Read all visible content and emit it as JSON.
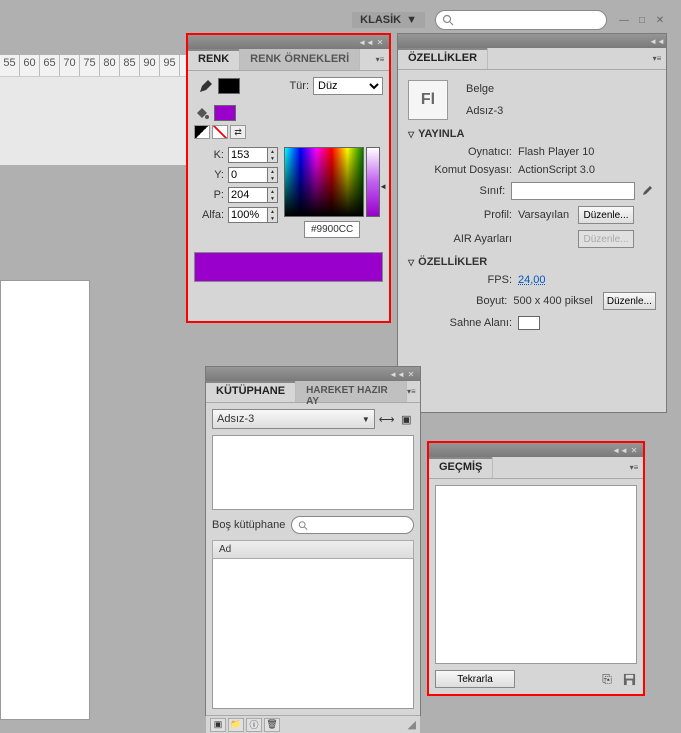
{
  "topbar": {
    "workspace": "KLASİK",
    "search_placeholder": ""
  },
  "ruler_ticks": [
    "55",
    "60",
    "65",
    "70",
    "75",
    "80",
    "85",
    "90",
    "95"
  ],
  "renk": {
    "tab_active": "RENK",
    "tab_inactive": "RENK ÖRNEKLERİ",
    "tur_label": "Tür:",
    "tur_value": "Düz",
    "stroke_color": "#000000",
    "fill_color": "#9900CC",
    "k_label": "K:",
    "k_value": "153",
    "y_label": "Y:",
    "y_value": "0",
    "p_label": "P:",
    "p_value": "204",
    "alfa_label": "Alfa:",
    "alfa_value": "100%",
    "hex": "#9900CC"
  },
  "ozellik": {
    "tab": "ÖZELLİKLER",
    "doc_icon_text": "Fl",
    "belge_label": "Belge",
    "dosya_name": "Adsız-3",
    "yayinla_header": "YAYINLA",
    "oynatici_label": "Oynatıcı:",
    "oynatici_value": "Flash Player 10",
    "komut_label": "Komut Dosyası:",
    "komut_value": "ActionScript 3.0",
    "sinif_label": "Sınıf:",
    "sinif_value": "",
    "profil_label": "Profil:",
    "profil_value": "Varsayılan",
    "air_label": "AIR Ayarları",
    "ozellik_header": "ÖZELLİKLER",
    "fps_label": "FPS:",
    "fps_value": "24,00",
    "boyut_label": "Boyut:",
    "boyut_value": "500 x 400 piksel",
    "sahne_label": "Sahne Alanı:",
    "duzenle_btn": "Düzenle..."
  },
  "kutuphane": {
    "tab_active": "KÜTÜPHANE",
    "tab_inactive": "HAREKET HAZIR AY",
    "doc_select": "Adsız-3",
    "empty_label": "Boş kütüphane",
    "search_placeholder": "",
    "col_header": "Ad"
  },
  "gecmis": {
    "tab": "GEÇMİŞ",
    "tekrarla_btn": "Tekrarla"
  }
}
